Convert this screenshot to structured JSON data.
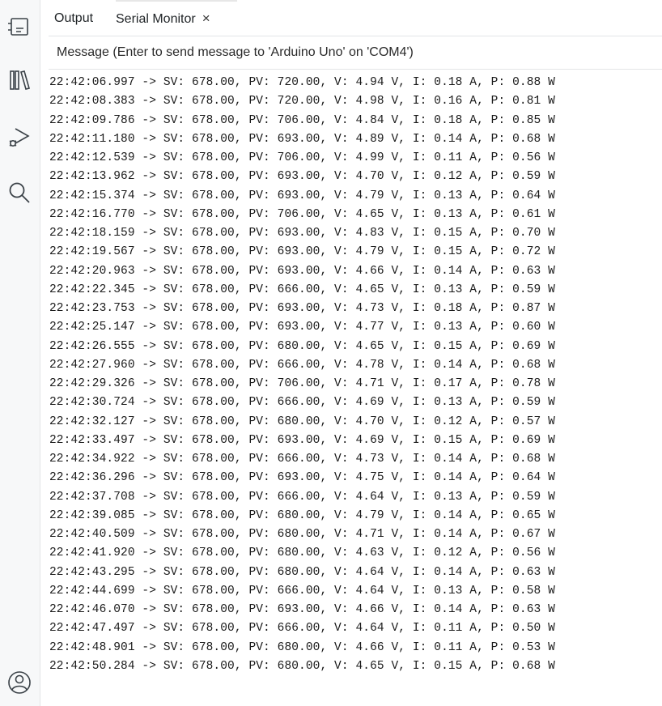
{
  "sidebar": {
    "icons": [
      "board-icon",
      "library-icon",
      "debug-icon",
      "search-icon",
      "profile-icon"
    ]
  },
  "tabs": {
    "output_label": "Output",
    "serial_label": "Serial Monitor",
    "close_glyph": "×"
  },
  "message": {
    "placeholder": "Message (Enter to send message to 'Arduino Uno' on 'COM4')"
  },
  "log": {
    "lines": [
      "22:42:06.997 -> SV: 678.00, PV: 720.00, V: 4.94 V, I: 0.18 A, P: 0.88 W",
      "22:42:08.383 -> SV: 678.00, PV: 720.00, V: 4.98 V, I: 0.16 A, P: 0.81 W",
      "22:42:09.786 -> SV: 678.00, PV: 706.00, V: 4.84 V, I: 0.18 A, P: 0.85 W",
      "22:42:11.180 -> SV: 678.00, PV: 693.00, V: 4.89 V, I: 0.14 A, P: 0.68 W",
      "22:42:12.539 -> SV: 678.00, PV: 706.00, V: 4.99 V, I: 0.11 A, P: 0.56 W",
      "22:42:13.962 -> SV: 678.00, PV: 693.00, V: 4.70 V, I: 0.12 A, P: 0.59 W",
      "22:42:15.374 -> SV: 678.00, PV: 693.00, V: 4.79 V, I: 0.13 A, P: 0.64 W",
      "22:42:16.770 -> SV: 678.00, PV: 706.00, V: 4.65 V, I: 0.13 A, P: 0.61 W",
      "22:42:18.159 -> SV: 678.00, PV: 693.00, V: 4.83 V, I: 0.15 A, P: 0.70 W",
      "22:42:19.567 -> SV: 678.00, PV: 693.00, V: 4.79 V, I: 0.15 A, P: 0.72 W",
      "22:42:20.963 -> SV: 678.00, PV: 693.00, V: 4.66 V, I: 0.14 A, P: 0.63 W",
      "22:42:22.345 -> SV: 678.00, PV: 666.00, V: 4.65 V, I: 0.13 A, P: 0.59 W",
      "22:42:23.753 -> SV: 678.00, PV: 693.00, V: 4.73 V, I: 0.18 A, P: 0.87 W",
      "22:42:25.147 -> SV: 678.00, PV: 693.00, V: 4.77 V, I: 0.13 A, P: 0.60 W",
      "22:42:26.555 -> SV: 678.00, PV: 680.00, V: 4.65 V, I: 0.15 A, P: 0.69 W",
      "22:42:27.960 -> SV: 678.00, PV: 666.00, V: 4.78 V, I: 0.14 A, P: 0.68 W",
      "22:42:29.326 -> SV: 678.00, PV: 706.00, V: 4.71 V, I: 0.17 A, P: 0.78 W",
      "22:42:30.724 -> SV: 678.00, PV: 666.00, V: 4.69 V, I: 0.13 A, P: 0.59 W",
      "22:42:32.127 -> SV: 678.00, PV: 680.00, V: 4.70 V, I: 0.12 A, P: 0.57 W",
      "22:42:33.497 -> SV: 678.00, PV: 693.00, V: 4.69 V, I: 0.15 A, P: 0.69 W",
      "22:42:34.922 -> SV: 678.00, PV: 666.00, V: 4.73 V, I: 0.14 A, P: 0.68 W",
      "22:42:36.296 -> SV: 678.00, PV: 693.00, V: 4.75 V, I: 0.14 A, P: 0.64 W",
      "22:42:37.708 -> SV: 678.00, PV: 666.00, V: 4.64 V, I: 0.13 A, P: 0.59 W",
      "22:42:39.085 -> SV: 678.00, PV: 680.00, V: 4.79 V, I: 0.14 A, P: 0.65 W",
      "22:42:40.509 -> SV: 678.00, PV: 680.00, V: 4.71 V, I: 0.14 A, P: 0.67 W",
      "22:42:41.920 -> SV: 678.00, PV: 680.00, V: 4.63 V, I: 0.12 A, P: 0.56 W",
      "22:42:43.295 -> SV: 678.00, PV: 680.00, V: 4.64 V, I: 0.14 A, P: 0.63 W",
      "22:42:44.699 -> SV: 678.00, PV: 666.00, V: 4.64 V, I: 0.13 A, P: 0.58 W",
      "22:42:46.070 -> SV: 678.00, PV: 693.00, V: 4.66 V, I: 0.14 A, P: 0.63 W",
      "22:42:47.497 -> SV: 678.00, PV: 666.00, V: 4.64 V, I: 0.11 A, P: 0.50 W",
      "22:42:48.901 -> SV: 678.00, PV: 680.00, V: 4.66 V, I: 0.11 A, P: 0.53 W",
      "22:42:50.284 -> SV: 678.00, PV: 680.00, V: 4.65 V, I: 0.15 A, P: 0.68 W"
    ]
  }
}
